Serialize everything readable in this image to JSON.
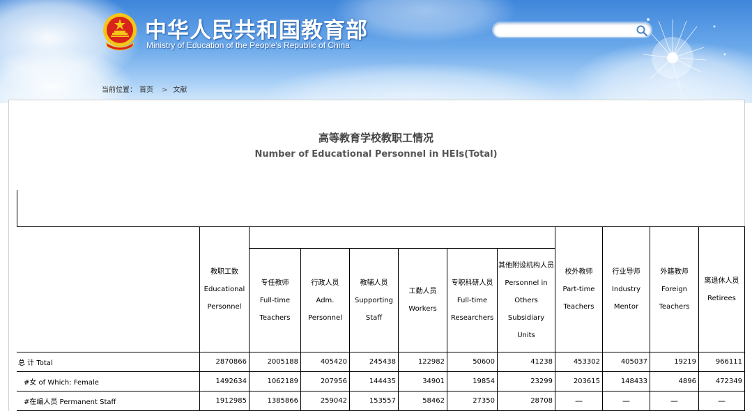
{
  "header": {
    "title_cn": "中华人民共和国教育部",
    "title_en": "Ministry of Education of the People's Republic of China",
    "search_placeholder": ""
  },
  "breadcrumb": {
    "prefix": "当前位置：",
    "home": "首页",
    "separator": ">",
    "current": "文献"
  },
  "document": {
    "title": "高等教育学校教职工情况",
    "subtitle": "Number of Educational Personnel in HEIs(Total)"
  },
  "table": {
    "columns": [
      {
        "key": "educational_personnel",
        "lines": [
          "教职工数",
          "Educational",
          "Personnel"
        ]
      },
      {
        "key": "fulltime_teachers",
        "lines": [
          "专任教师",
          "Full-time",
          "Teachers"
        ]
      },
      {
        "key": "adm_personnel",
        "lines": [
          "行政人员",
          "Adm.",
          "Personnel"
        ]
      },
      {
        "key": "supporting_staff",
        "lines": [
          "教辅人员",
          "Supporting",
          "Staff"
        ]
      },
      {
        "key": "workers",
        "lines": [
          "工勤人员",
          "Workers"
        ]
      },
      {
        "key": "fulltime_researchers",
        "lines": [
          "专职科研人员",
          "Full-time",
          "Researchers"
        ]
      },
      {
        "key": "others_subsidiary",
        "lines": [
          "其他附设机构人员",
          "Personnel in",
          "Others",
          "Subsidiary",
          "Units"
        ]
      },
      {
        "key": "parttime_teachers",
        "lines": [
          "校外教师",
          "Part-time",
          "Teachers"
        ]
      },
      {
        "key": "industry_mentor",
        "lines": [
          "行业导师",
          "Industry",
          "Mentor"
        ]
      },
      {
        "key": "foreign_teachers",
        "lines": [
          "外籍教师",
          "Foreign",
          "Teachers"
        ]
      },
      {
        "key": "retirees",
        "lines": [
          "离退休人员",
          "Retirees"
        ]
      }
    ],
    "rows": [
      {
        "label": "总  计  Total",
        "values": [
          "2870866",
          "2005188",
          "405420",
          "245438",
          "122982",
          "50600",
          "41238",
          "453302",
          "405037",
          "19219",
          "966111"
        ]
      },
      {
        "label": "#女 of Which: Female",
        "values": [
          "1492634",
          "1062189",
          "207956",
          "144435",
          "34901",
          "19854",
          "23299",
          "203615",
          "148433",
          "4896",
          "472349"
        ]
      },
      {
        "label": "#在编人员 Permanent Staff",
        "values": [
          "1912985",
          "1385866",
          "259042",
          "153557",
          "58462",
          "27350",
          "28708",
          "—",
          "—",
          "—",
          "—"
        ]
      }
    ]
  },
  "colors": {
    "header_top": "#3f86db",
    "header_bottom": "#d6e9fb",
    "emblem_red": "#d9241c",
    "emblem_gold": "#f5c518"
  }
}
